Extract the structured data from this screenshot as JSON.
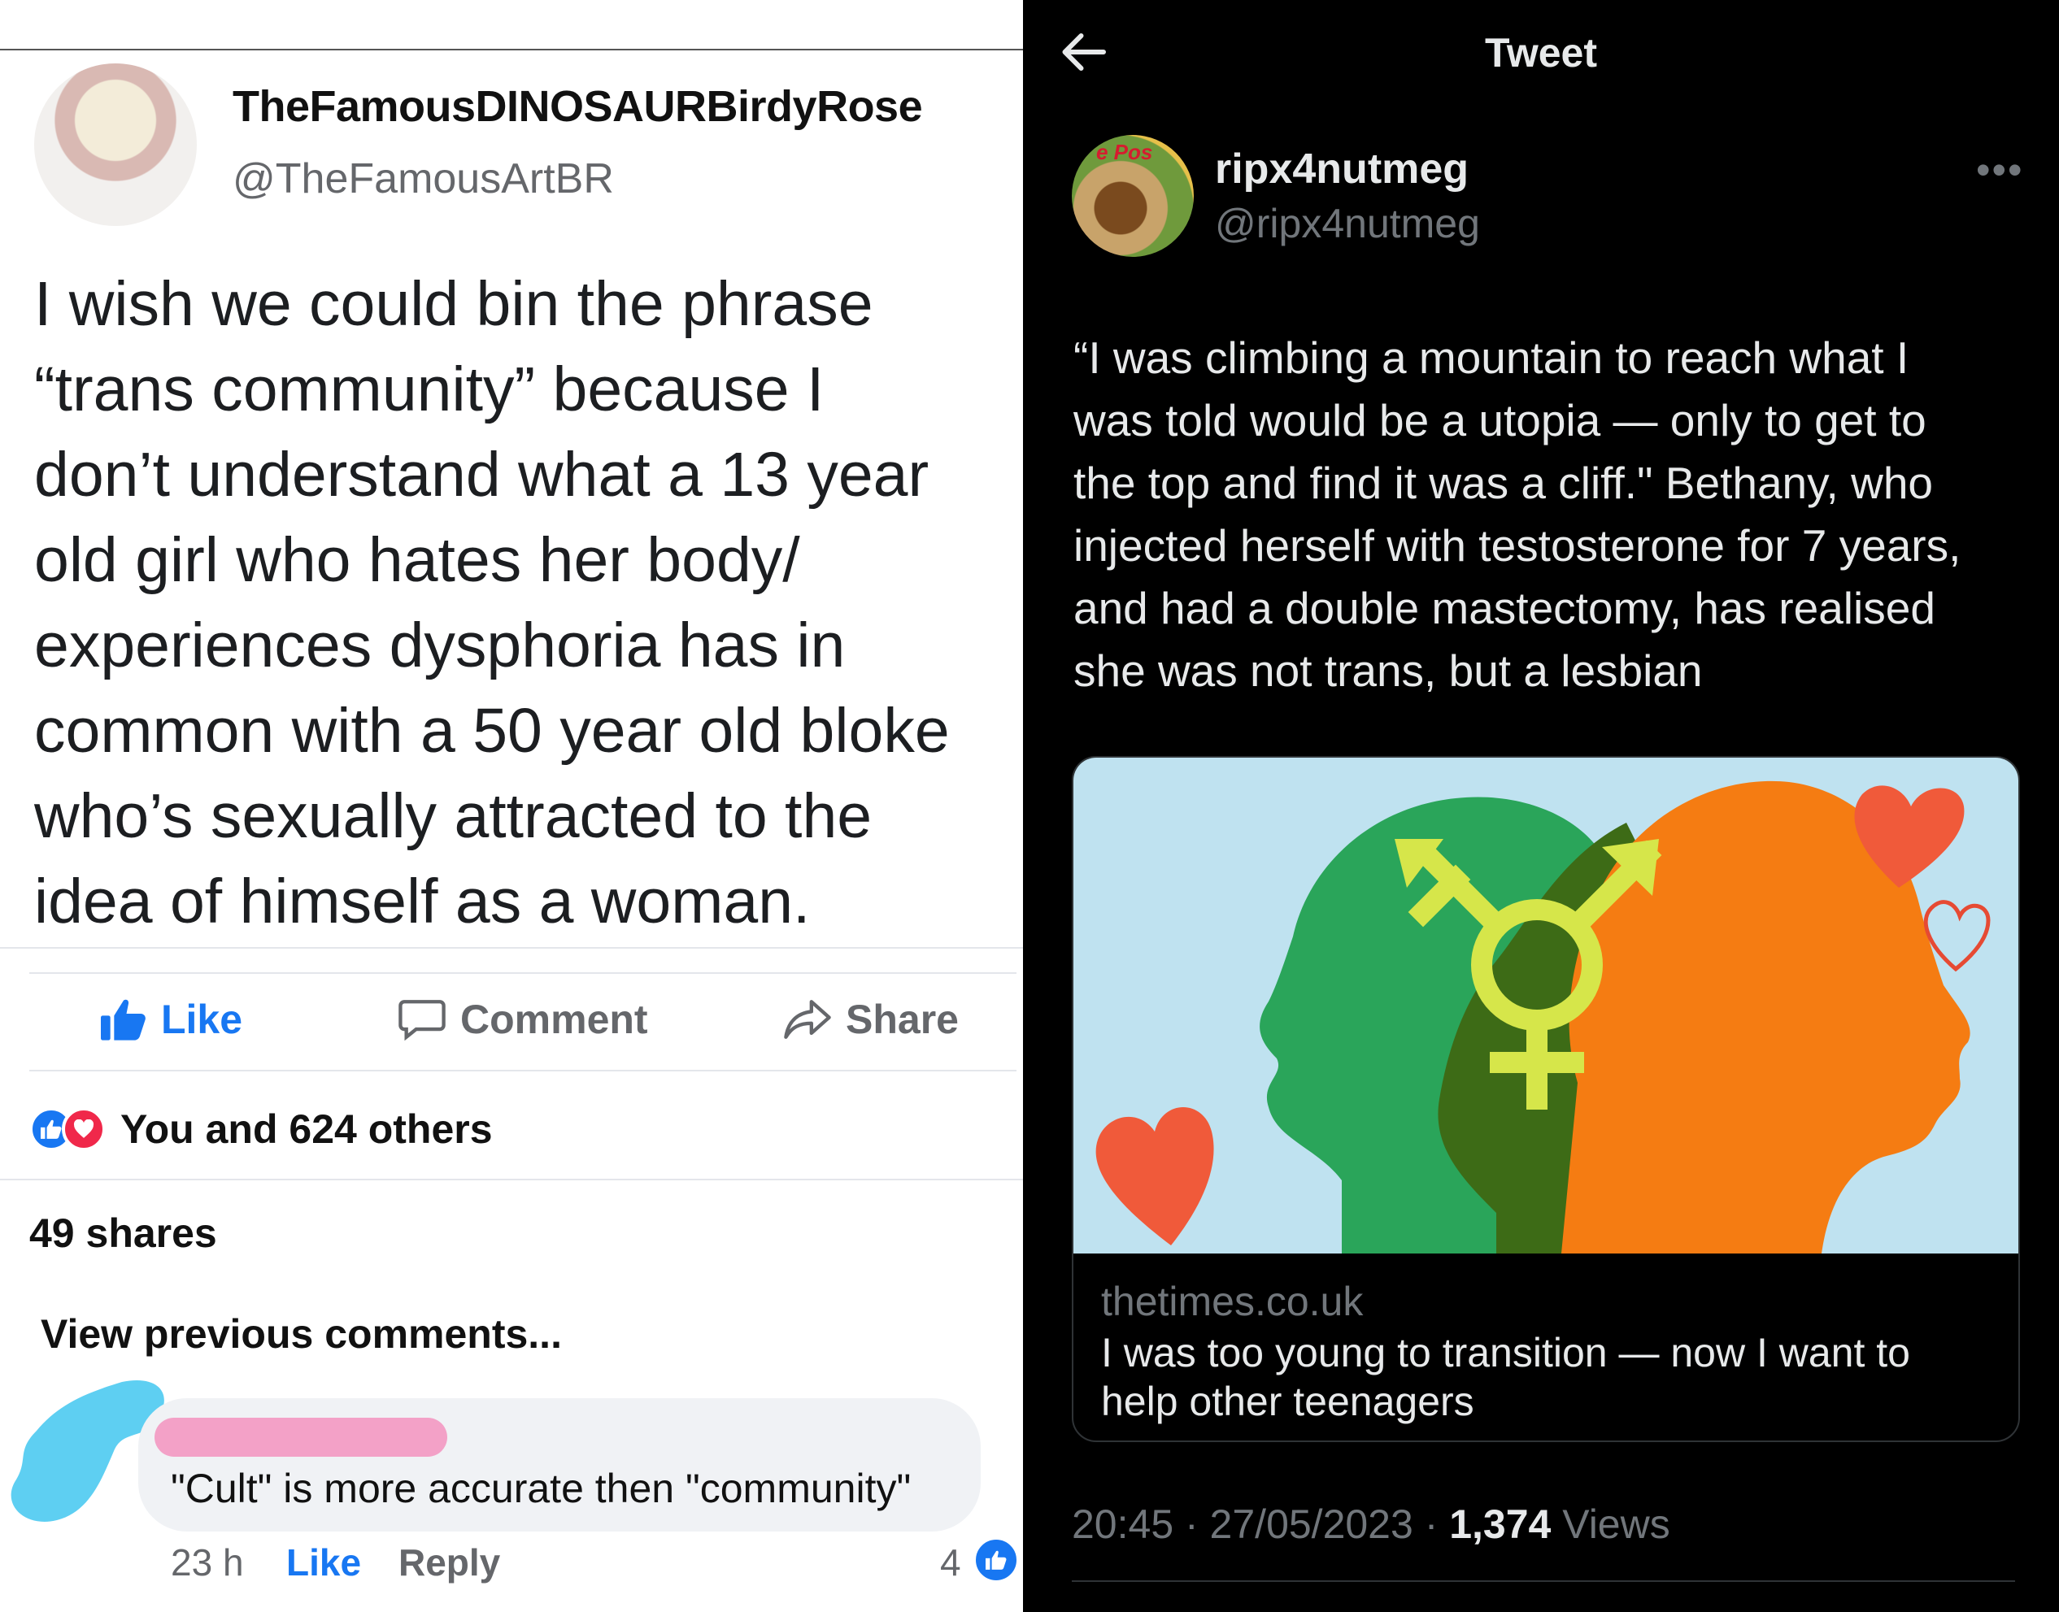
{
  "facebook": {
    "author": {
      "name": "TheFamousDINOSAURBirdyRose",
      "handle": "@TheFamousArtBR"
    },
    "post_lines": [
      "I wish we could bin the phrase",
      "“trans community” because I",
      "don’t understand what a 13 year",
      "old girl who hates her body/",
      "experiences dysphoria has in",
      "common with a 50 year old bloke",
      "who’s sexually attracted to the",
      "idea of himself as a woman."
    ],
    "actions": {
      "like": "Like",
      "comment": "Comment",
      "share": "Share"
    },
    "reactions_text": "You and 624 others",
    "shares_text": "49 shares",
    "view_previous": "View previous comments...",
    "comment": {
      "text": "\"Cult\" is more accurate then \"community\"",
      "time": "23 h",
      "like": "Like",
      "reply": "Reply",
      "reaction_count": "4"
    },
    "colors": {
      "accent": "#1877f2",
      "love": "#f0284a"
    }
  },
  "twitter": {
    "header_title": "Tweet",
    "author": {
      "name": "ripx4nutmeg",
      "handle": "@ripx4nutmeg",
      "avatar_text": "e Pos"
    },
    "tweet_lines": [
      "“I was climbing a mountain to reach what I",
      "was told would be a utopia — only to get to",
      "the top and find it was a cliff.\" Bethany, who",
      "injected herself with testosterone for 7 years,",
      "and had a double mastectomy, has realised",
      "she was not trans, but a lesbian"
    ],
    "card": {
      "domain": "thetimes.co.uk",
      "title_lines": [
        "I was too young to transition — now I want to",
        "help other teenagers"
      ]
    },
    "timestamp": "20:45 · 27/05/2023 · ",
    "views_count": "1,374",
    "views_label": " Views",
    "colors": {
      "background": "#000000",
      "muted": "#71767b"
    }
  }
}
